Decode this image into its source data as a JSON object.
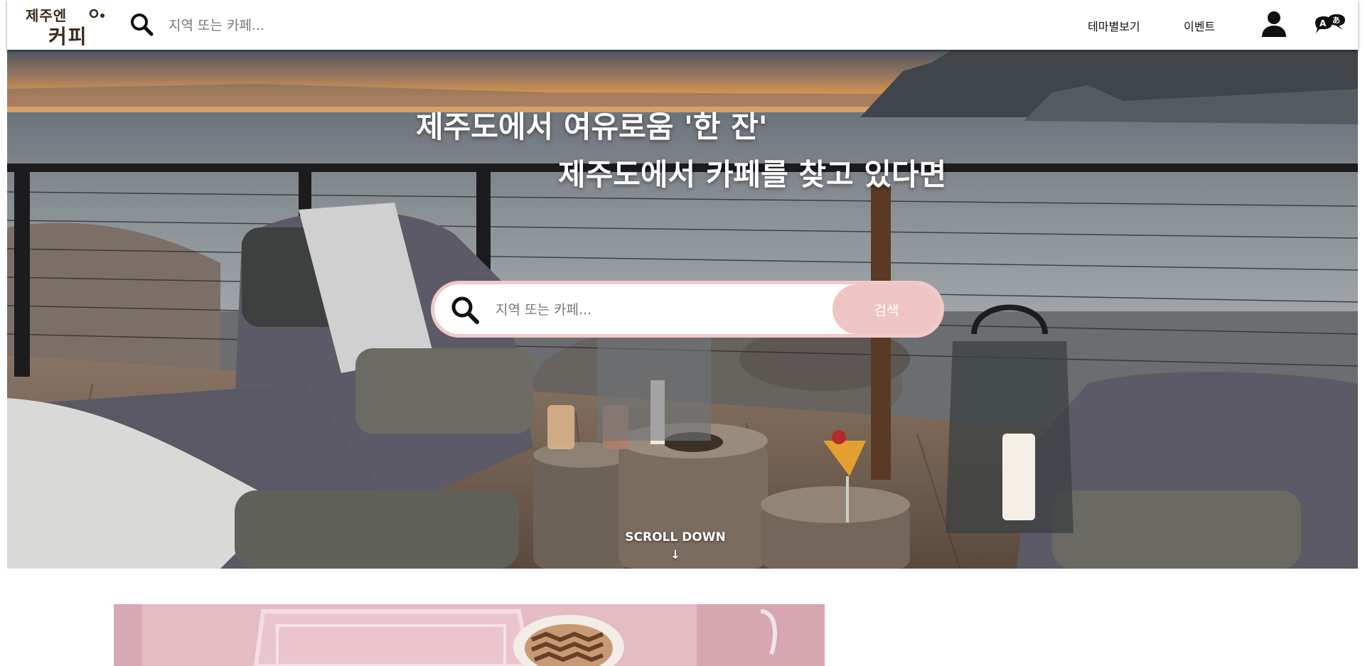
{
  "header": {
    "logo": {
      "line1": "제주엔",
      "line2": "커피"
    },
    "search": {
      "placeholder": "지역 또는 카페...",
      "value": ""
    },
    "nav": {
      "theme_label": "테마별보기",
      "event_label": "이벤트"
    },
    "icons": {
      "search": "search-icon",
      "user": "user-icon",
      "language": "language-icon"
    }
  },
  "hero": {
    "title_line1": "제주도에서 여유로움 '한 잔'",
    "title_line2": "제주도에서 카페를 찾고 있다면",
    "search": {
      "placeholder": "지역 또는 카페...",
      "value": "",
      "button_label": "검색"
    },
    "scroll_label": "SCROLL DOWN",
    "scroll_arrow": "↓"
  },
  "colors": {
    "accent_pink": "#efc4c4",
    "search_ring": "#f1c9c9",
    "text_dark": "#111111",
    "hero_text": "#ffffff"
  }
}
